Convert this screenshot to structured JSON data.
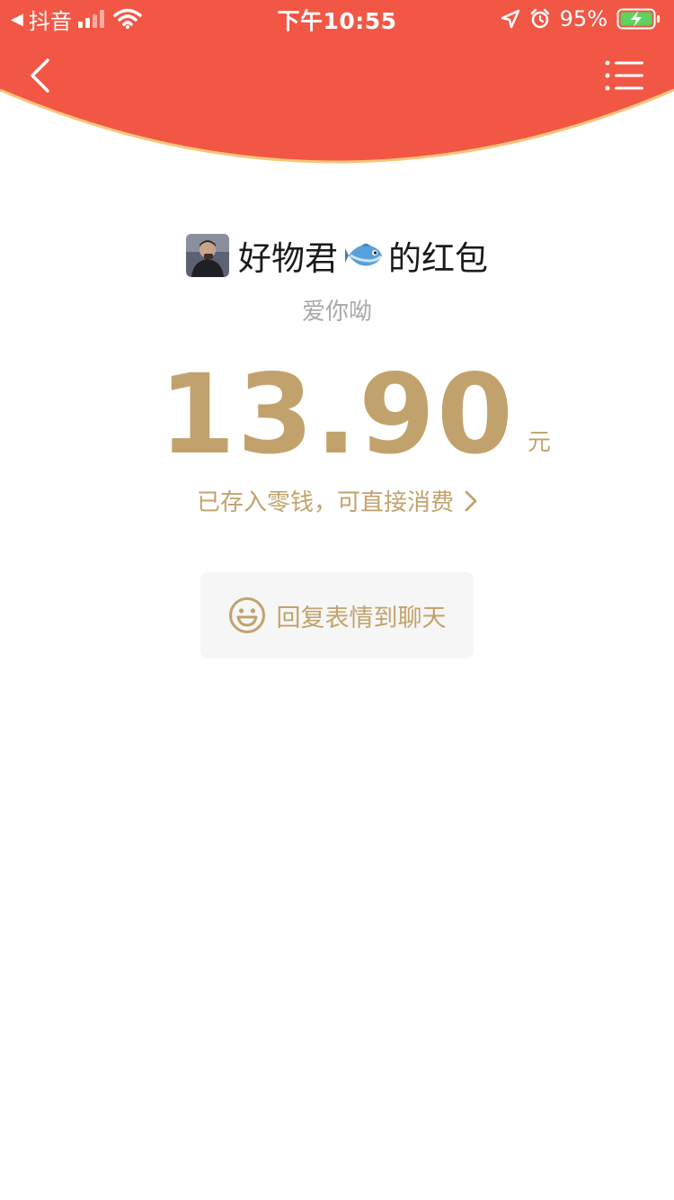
{
  "status_bar": {
    "back_app": "抖音",
    "time": "下午10:55",
    "battery": "95%"
  },
  "envelope": {
    "sender_name": "好物君",
    "title_suffix": "的红包",
    "greeting": "爱你呦",
    "amount": "13.90",
    "currency": "元",
    "deposit_text": "已存入零钱，可直接消费",
    "reply_label": "回复表情到聊天"
  },
  "colors": {
    "header_red": "#f25745",
    "header_rim": "#f7c57a",
    "gold": "#c2a26c",
    "reply_bg": "#f6f6f6"
  },
  "icons": [
    "back-arrow-icon",
    "list-menu-icon",
    "fish-emoji-icon",
    "smile-icon",
    "chevron-right-icon",
    "signal-icon",
    "wifi-icon",
    "location-icon",
    "alarm-icon",
    "battery-charging-icon"
  ]
}
